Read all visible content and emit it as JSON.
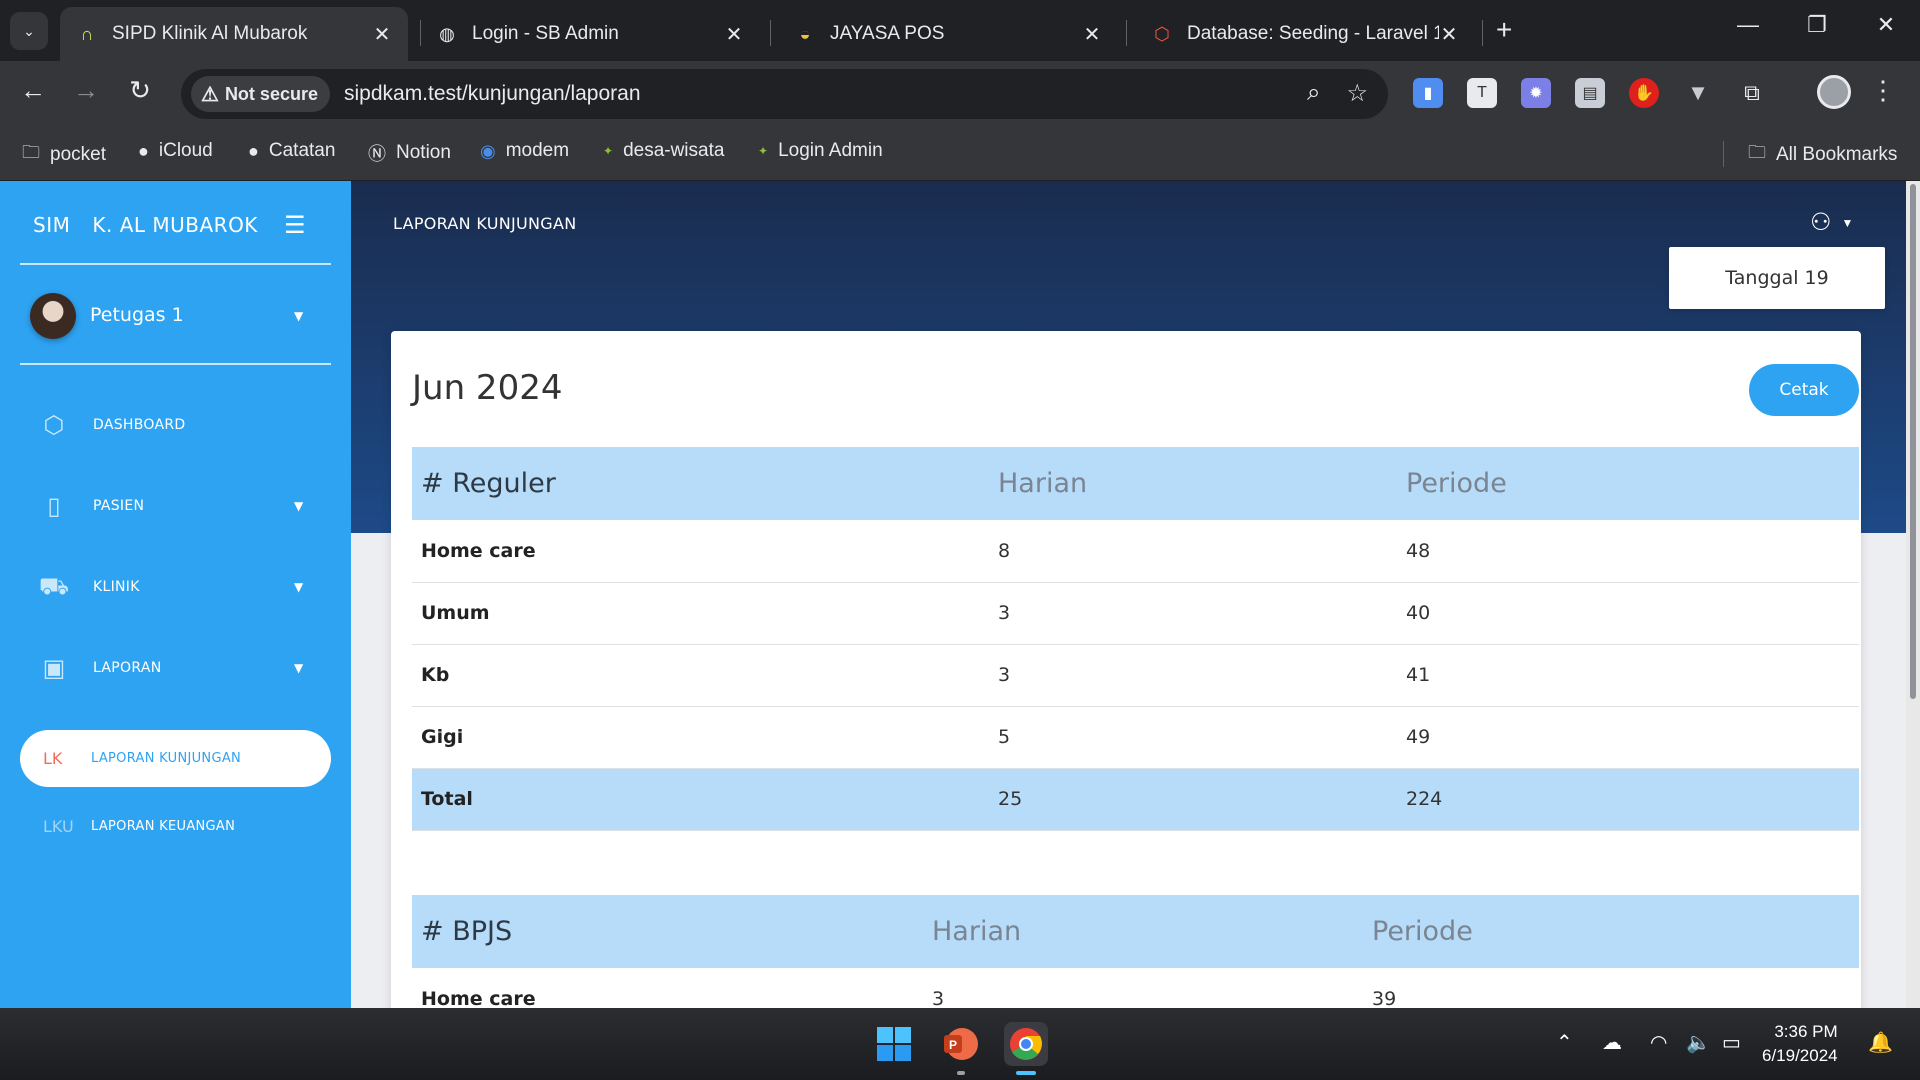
{
  "browser": {
    "tabs": [
      {
        "title": "SIPD Klinik Al Mubarok",
        "icon": "laravel-arch-icon",
        "active": true
      },
      {
        "title": "Login - SB Admin",
        "icon": "globe-icon",
        "active": false
      },
      {
        "title": "JAYASA POS",
        "icon": "pos-logo-icon",
        "active": false
      },
      {
        "title": "Database: Seeding - Laravel 11.",
        "icon": "laravel-icon",
        "active": false
      }
    ],
    "security_label": "Not secure",
    "url": "sipdkam.test/kunjungan/laporan",
    "bookmarks": [
      "pocket",
      "iCloud",
      "Catatan",
      "Notion",
      "modem",
      "desa-wisata",
      "Login Admin"
    ],
    "all_bookmarks": "All Bookmarks"
  },
  "sidebar": {
    "brand_short": "SIM",
    "brand_name": "K. AL MUBAROK",
    "user": "Petugas 1",
    "items": [
      {
        "label": "DASHBOARD",
        "icon": "cube-icon"
      },
      {
        "label": "PASIEN",
        "icon": "book-icon"
      },
      {
        "label": "KLINIK",
        "icon": "ambulance-icon"
      },
      {
        "label": "LAPORAN",
        "icon": "briefcase-icon"
      }
    ],
    "subitems": [
      {
        "abbr": "LK",
        "label": "LAPORAN KUNJUNGAN",
        "active": true
      },
      {
        "abbr": "LKU",
        "label": "LAPORAN KEUANGAN",
        "active": false
      }
    ]
  },
  "header": {
    "title": "LAPORAN KUNJUNGAN",
    "date_label": "Tanggal 19"
  },
  "report": {
    "period": "Jun 2024",
    "print_label": "Cetak",
    "reguler": {
      "headers": [
        "# Reguler",
        "Harian",
        "Periode"
      ],
      "rows": [
        {
          "label": "Home care",
          "harian": "8",
          "periode": "48"
        },
        {
          "label": "Umum",
          "harian": "3",
          "periode": "40"
        },
        {
          "label": "Kb",
          "harian": "3",
          "periode": "41"
        },
        {
          "label": "Gigi",
          "harian": "5",
          "periode": "49"
        }
      ],
      "total": {
        "label": "Total",
        "harian": "25",
        "periode": "224"
      }
    },
    "bpjs": {
      "headers": [
        "# BPJS",
        "Harian",
        "Periode"
      ],
      "rows": [
        {
          "label": "Home care",
          "harian": "3",
          "periode": "39"
        }
      ]
    }
  },
  "taskbar": {
    "time": "3:36 PM",
    "date": "6/19/2024"
  },
  "colors": {
    "sidebar": "#2ea3f2",
    "header_gradient_top": "#1a2c4e",
    "table_header": "#b7dcfa",
    "active_abbr": "#f26b5b"
  }
}
